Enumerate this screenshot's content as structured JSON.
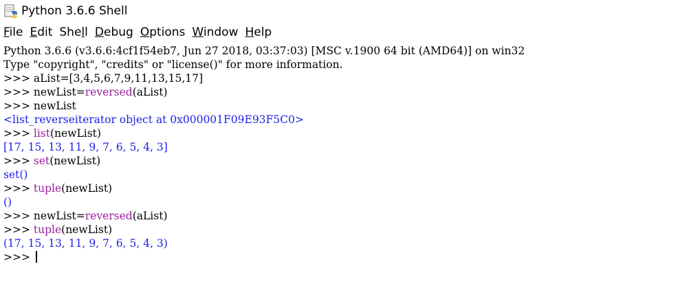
{
  "window": {
    "title": "Python 3.6.6 Shell",
    "icon": "python-idle-icon"
  },
  "menu": [
    {
      "label": "File",
      "u": "F",
      "rest": "ile"
    },
    {
      "label": "Edit",
      "u": "E",
      "rest": "dit"
    },
    {
      "label": "Shell",
      "pre": "She",
      "u": "l",
      "rest": "l"
    },
    {
      "label": "Debug",
      "u": "D",
      "rest": "ebug"
    },
    {
      "label": "Options",
      "u": "O",
      "rest": "ptions"
    },
    {
      "label": "Window",
      "u": "W",
      "rest": "indow"
    },
    {
      "label": "Help",
      "u": "H",
      "rest": "elp"
    }
  ],
  "shell": {
    "banner1": "Python 3.6.6 (v3.6.6:4cf1f54eb7, Jun 27 2018, 03:37:03) [MSC v.1900 64 bit (AMD64)] on win32",
    "banner2": "Type \"copyright\", \"credits\" or \"license()\" for more information.",
    "prompt": ">>> ",
    "l3": "aList=[3,4,5,6,7,9,11,13,15,17]",
    "l4_a": "newList=",
    "l4_fn": "reversed",
    "l4_b": "(aList)",
    "l5": "newList",
    "l6": "<list_reverseiterator object at 0x000001F09E93F5C0>",
    "l7_fn": "list",
    "l7_b": "(newList)",
    "l8": "[17, 15, 13, 11, 9, 7, 6, 5, 4, 3]",
    "l9_fn": "set",
    "l9_b": "(newList)",
    "l10": "set()",
    "l11_fn": "tuple",
    "l11_b": "(newList)",
    "l12": "()",
    "l13_a": "newList=",
    "l13_fn": "reversed",
    "l13_b": "(aList)",
    "l14_fn": "tuple",
    "l14_b": "(newList)",
    "l15": "(17, 15, 13, 11, 9, 7, 6, 5, 4, 3)"
  }
}
